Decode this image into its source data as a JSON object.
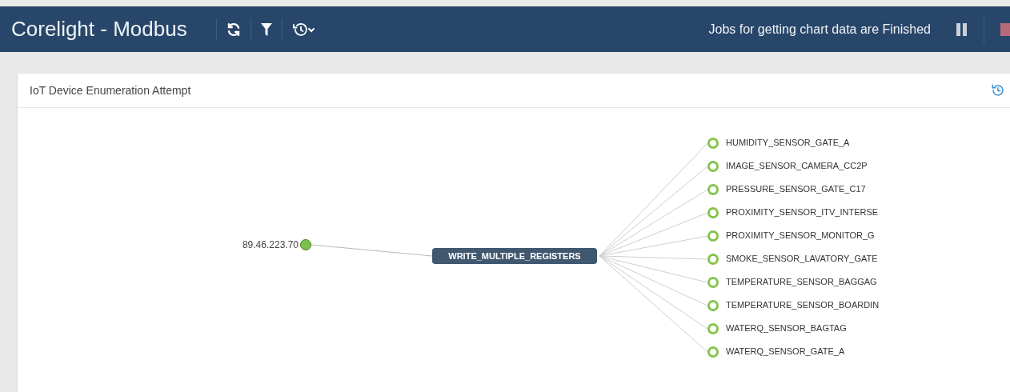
{
  "header": {
    "title": "Corelight - Modbus",
    "status": "Jobs for getting chart data are Finished"
  },
  "card": {
    "title": "IoT Device Enumeration Attempt",
    "graph": {
      "source": {
        "label": "89.46.223.70"
      },
      "action": {
        "label": "WRITE_MULTIPLE_REGISTERS"
      },
      "targets": [
        {
          "label": "HUMIDITY_SENSOR_GATE_A"
        },
        {
          "label": "IMAGE_SENSOR_CAMERA_CC2P"
        },
        {
          "label": "PRESSURE_SENSOR_GATE_C17"
        },
        {
          "label": "PROXIMITY_SENSOR_ITV_INTERSE"
        },
        {
          "label": "PROXIMITY_SENSOR_MONITOR_G"
        },
        {
          "label": "SMOKE_SENSOR_LAVATORY_GATE"
        },
        {
          "label": "TEMPERATURE_SENSOR_BAGGAG"
        },
        {
          "label": "TEMPERATURE_SENSOR_BOARDIN"
        },
        {
          "label": "WATERQ_SENSOR_BAGTAG"
        },
        {
          "label": "WATERQ_SENSOR_GATE_A"
        }
      ]
    }
  }
}
